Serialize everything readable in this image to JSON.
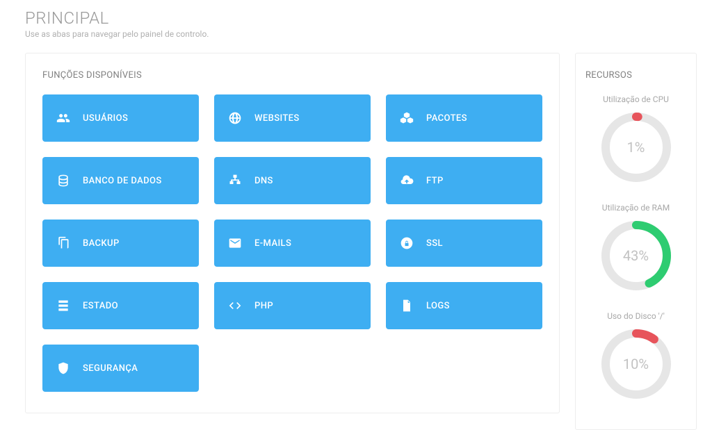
{
  "header": {
    "title": "PRINCIPAL",
    "subtitle": "Use as abas para navegar pelo painel de controlo."
  },
  "functions": {
    "title": "FUNÇÕES DISPONÍVEIS",
    "tiles": [
      {
        "label": "USUÁRIOS",
        "icon": "users"
      },
      {
        "label": "WEBSITES",
        "icon": "globe"
      },
      {
        "label": "PACOTES",
        "icon": "cubes"
      },
      {
        "label": "BANCO DE DADOS",
        "icon": "database"
      },
      {
        "label": "DNS",
        "icon": "sitemap"
      },
      {
        "label": "FTP",
        "icon": "cloud-upload"
      },
      {
        "label": "BACKUP",
        "icon": "copy"
      },
      {
        "label": "E-MAILS",
        "icon": "envelope"
      },
      {
        "label": "SSL",
        "icon": "lock-circle"
      },
      {
        "label": "ESTADO",
        "icon": "server"
      },
      {
        "label": "PHP",
        "icon": "code"
      },
      {
        "label": "LOGS",
        "icon": "file"
      },
      {
        "label": "SEGURANÇA",
        "icon": "shield"
      }
    ]
  },
  "resources": {
    "title": "RECURSOS",
    "gauges": [
      {
        "label": "Utilização de CPU",
        "value": 1,
        "text": "1%",
        "color": "#e7545b"
      },
      {
        "label": "Utilização de RAM",
        "value": 43,
        "text": "43%",
        "color": "#2ecc71"
      },
      {
        "label": "Uso do Disco '/'",
        "value": 10,
        "text": "10%",
        "color": "#e7545b"
      }
    ]
  },
  "chart_data": [
    {
      "type": "pie",
      "title": "Utilização de CPU",
      "values": [
        1,
        99
      ],
      "ylim": [
        0,
        100
      ]
    },
    {
      "type": "pie",
      "title": "Utilização de RAM",
      "values": [
        43,
        57
      ],
      "ylim": [
        0,
        100
      ]
    },
    {
      "type": "pie",
      "title": "Uso do Disco '/'",
      "values": [
        10,
        90
      ],
      "ylim": [
        0,
        100
      ]
    }
  ]
}
